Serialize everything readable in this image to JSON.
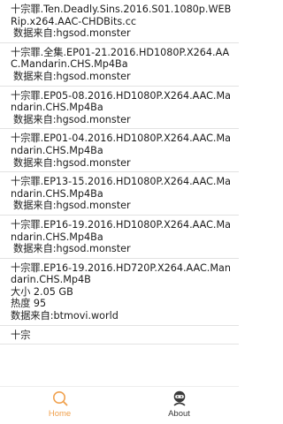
{
  "list": {
    "items": [
      {
        "title": "十宗罪.Ten.Deadly.Sins.2016.S01.1080p.WEBRip.x264.AAC-CHDBits.cc",
        "source": "数据来自:hgsod.monster"
      },
      {
        "title": "十宗罪.全集.EP01-21.2016.HD1080P.X264.AAC.Mandarin.CHS.Mp4Ba",
        "source": "数据来自:hgsod.monster"
      },
      {
        "title": "十宗罪.EP05-08.2016.HD1080P.X264.AAC.Mandarin.CHS.Mp4Ba",
        "source": "数据来自:hgsod.monster"
      },
      {
        "title": "十宗罪.EP01-04.2016.HD1080P.X264.AAC.Mandarin.CHS.Mp4Ba",
        "source": "数据来自:hgsod.monster"
      },
      {
        "title": "十宗罪.EP13-15.2016.HD1080P.X264.AAC.Mandarin.CHS.Mp4Ba",
        "source": "数据来自:hgsod.monster"
      },
      {
        "title": "十宗罪.EP16-19.2016.HD1080P.X264.AAC.Mandarin.CHS.Mp4Ba",
        "source": "数据来自:hgsod.monster"
      },
      {
        "title": "十宗罪.EP16-19.2016.HD720P.X264.AAC.Mandarin.CHS.Mp4B",
        "size": "大小 2.05 GB",
        "heat": "热度 95",
        "source": "数据来自:btmovi.world"
      },
      {
        "title": "十宗"
      }
    ]
  },
  "tabbar": {
    "home_label": "Home",
    "home_icon": "search-icon",
    "about_label": "About",
    "about_icon": "about-robot-icon",
    "active_color": "#f0a14e",
    "inactive_color": "#3a3a3a"
  }
}
